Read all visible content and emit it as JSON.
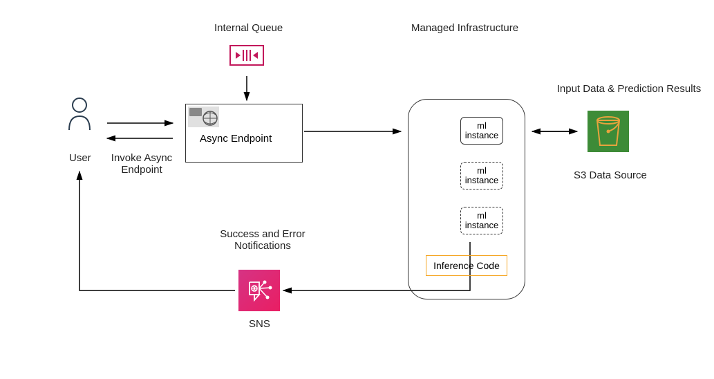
{
  "labels": {
    "user": "User",
    "invoke": "Invoke Async\nEndpoint",
    "internal_queue": "Internal Queue",
    "async_endpoint": "Async Endpoint",
    "managed_infra": "Managed Infrastructure",
    "ml_instance": "ml\ninstance",
    "inference_code": "Inference Code",
    "input_data": "Input Data & Prediction Results",
    "s3_source": "S3 Data Source",
    "success_error": "Success and Error\nNotifications",
    "sns": "SNS"
  }
}
